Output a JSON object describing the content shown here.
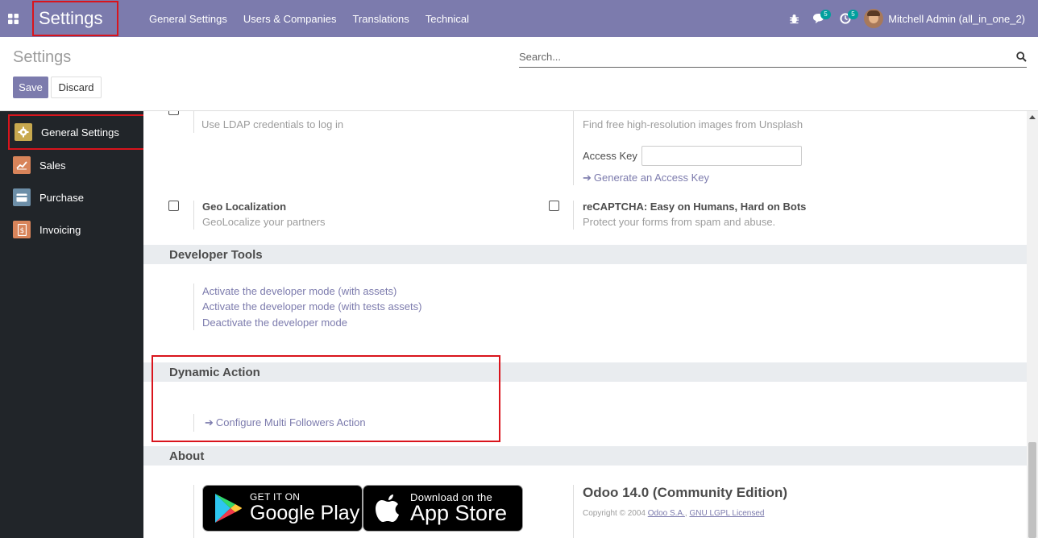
{
  "navbar": {
    "brand": "Settings",
    "menu": [
      "General Settings",
      "Users & Companies",
      "Translations",
      "Technical"
    ],
    "messages_count": "5",
    "activities_count": "5",
    "user_name": "Mitchell Admin (all_in_one_2)"
  },
  "control": {
    "title": "Settings",
    "save_label": "Save",
    "discard_label": "Discard",
    "search_placeholder": "Search..."
  },
  "sidebar": {
    "items": [
      {
        "label": "General Settings",
        "icon": "gear-icon",
        "color": "#c8a94f"
      },
      {
        "label": "Sales",
        "icon": "chart-icon",
        "color": "#d8845a"
      },
      {
        "label": "Purchase",
        "icon": "card-icon",
        "color": "#6d8fa8"
      },
      {
        "label": "Invoicing",
        "icon": "invoice-icon",
        "color": "#d8845a"
      }
    ]
  },
  "content": {
    "ldap_desc": "Use LDAP credentials to log in",
    "unsplash_desc": "Find free high-resolution images from Unsplash",
    "access_key_label": "Access Key",
    "generate_key_link": "Generate an Access Key",
    "geo_title": "Geo Localization",
    "geo_desc": "GeoLocalize your partners",
    "recaptcha_title": "reCAPTCHA: Easy on Humans, Hard on Bots",
    "recaptcha_desc": "Protect your forms from spam and abuse.",
    "dev_tools_header": "Developer Tools",
    "dev_links": [
      "Activate the developer mode (with assets)",
      "Activate the developer mode (with tests assets)",
      "Deactivate the developer mode"
    ],
    "dynamic_action_header": "Dynamic Action",
    "configure_followers_link": "Configure Multi Followers Action",
    "about_header": "About",
    "google_play": {
      "small": "GET IT ON",
      "big": "Google Play"
    },
    "app_store": {
      "small": "Download on the",
      "big": "App Store"
    },
    "odoo_version": "Odoo 14.0 (Community Edition)",
    "copyright_prefix": "Copyright © 2004",
    "copyright_company": "Odoo S.A.",
    "copyright_license": "GNU LGPL Licensed"
  }
}
